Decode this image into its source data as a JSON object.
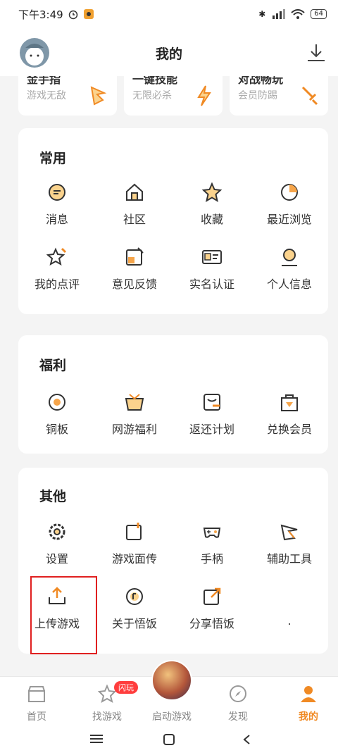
{
  "status": {
    "time": "下午3:49",
    "battery": "64"
  },
  "header": {
    "title": "我的"
  },
  "promos": [
    {
      "title": "金手指",
      "subtitle": "游戏无敌"
    },
    {
      "title": "一键技能",
      "subtitle": "无限必杀"
    },
    {
      "title": "对战畅玩",
      "subtitle": "会员防踢"
    }
  ],
  "common": {
    "title": "常用",
    "items": [
      {
        "label": "消息",
        "icon": "message-icon"
      },
      {
        "label": "社区",
        "icon": "community-icon"
      },
      {
        "label": "收藏",
        "icon": "favorite-icon"
      },
      {
        "label": "最近浏览",
        "icon": "history-icon"
      },
      {
        "label": "我的点评",
        "icon": "review-icon"
      },
      {
        "label": "意见反馈",
        "icon": "feedback-icon"
      },
      {
        "label": "实名认证",
        "icon": "id-card-icon"
      },
      {
        "label": "个人信息",
        "icon": "profile-icon"
      }
    ]
  },
  "welfare": {
    "title": "福利",
    "items": [
      {
        "label": "铜板",
        "icon": "coin-icon"
      },
      {
        "label": "网游福利",
        "icon": "gift-icon"
      },
      {
        "label": "返还计划",
        "icon": "refund-icon"
      },
      {
        "label": "兑换会员",
        "icon": "shopping-bag-icon"
      }
    ]
  },
  "other": {
    "title": "其他",
    "items": [
      {
        "label": "设置",
        "icon": "gear-icon"
      },
      {
        "label": "游戏面传",
        "icon": "transfer-icon"
      },
      {
        "label": "手柄",
        "icon": "gamepad-icon"
      },
      {
        "label": "辅助工具",
        "icon": "tools-icon"
      },
      {
        "label": "上传游戏",
        "icon": "upload-icon"
      },
      {
        "label": "关于悟饭",
        "icon": "about-icon"
      },
      {
        "label": "分享悟饭",
        "icon": "share-icon"
      },
      {
        "label": ".",
        "icon": ""
      }
    ]
  },
  "tabs": [
    {
      "label": "首页"
    },
    {
      "label": "找游戏",
      "badge": "闪玩"
    },
    {
      "label": "启动游戏"
    },
    {
      "label": "发现"
    },
    {
      "label": "我的"
    }
  ],
  "colors": {
    "accent": "#f08a24",
    "highlight": "#e02020"
  }
}
